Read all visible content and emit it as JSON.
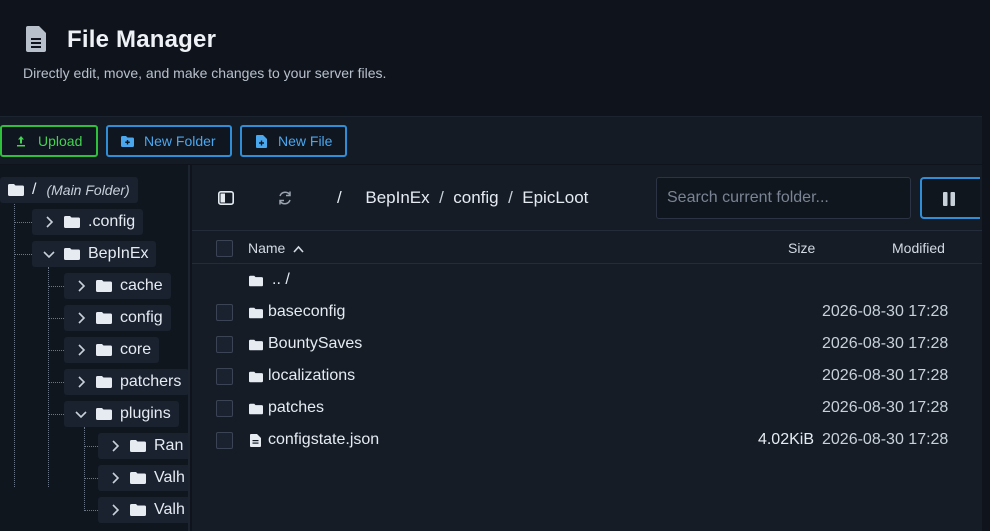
{
  "header": {
    "title": "File Manager",
    "subtitle": "Directly edit, move, and make changes to your server files."
  },
  "toolbar": {
    "upload_label": "Upload",
    "new_folder_label": "New Folder",
    "new_file_label": "New File"
  },
  "tree": {
    "root_label": "/",
    "root_sublabel": "(Main Folder)",
    "items": [
      {
        "label": ".config"
      },
      {
        "label": "BepInEx"
      },
      {
        "label": "cache"
      },
      {
        "label": "config"
      },
      {
        "label": "core"
      },
      {
        "label": "patchers"
      },
      {
        "label": "plugins"
      },
      {
        "label": "Ran"
      },
      {
        "label": "Valh"
      },
      {
        "label": "Valh"
      }
    ]
  },
  "breadcrumb": {
    "root": "/",
    "parts": [
      "BepInEx",
      "config",
      "EpicLoot"
    ]
  },
  "search": {
    "placeholder": "Search current folder..."
  },
  "table": {
    "headers": {
      "name": "Name",
      "size": "Size",
      "modified": "Modified"
    },
    "parent_label": ".. /",
    "rows": [
      {
        "name": "baseconfig",
        "type": "folder",
        "size": "",
        "modified": "2026-08-30 17:28"
      },
      {
        "name": "BountySaves",
        "type": "folder",
        "size": "",
        "modified": "2026-08-30 17:28"
      },
      {
        "name": "localizations",
        "type": "folder",
        "size": "",
        "modified": "2026-08-30 17:28"
      },
      {
        "name": "patches",
        "type": "folder",
        "size": "",
        "modified": "2026-08-30 17:28"
      },
      {
        "name": "configstate.json",
        "type": "file",
        "size": "4.02KiB",
        "modified": "2026-08-30 17:28"
      }
    ]
  },
  "colors": {
    "upload_accent": "#2fbf3c",
    "primary_accent": "#2f8ed8",
    "background": "#0f141c"
  }
}
